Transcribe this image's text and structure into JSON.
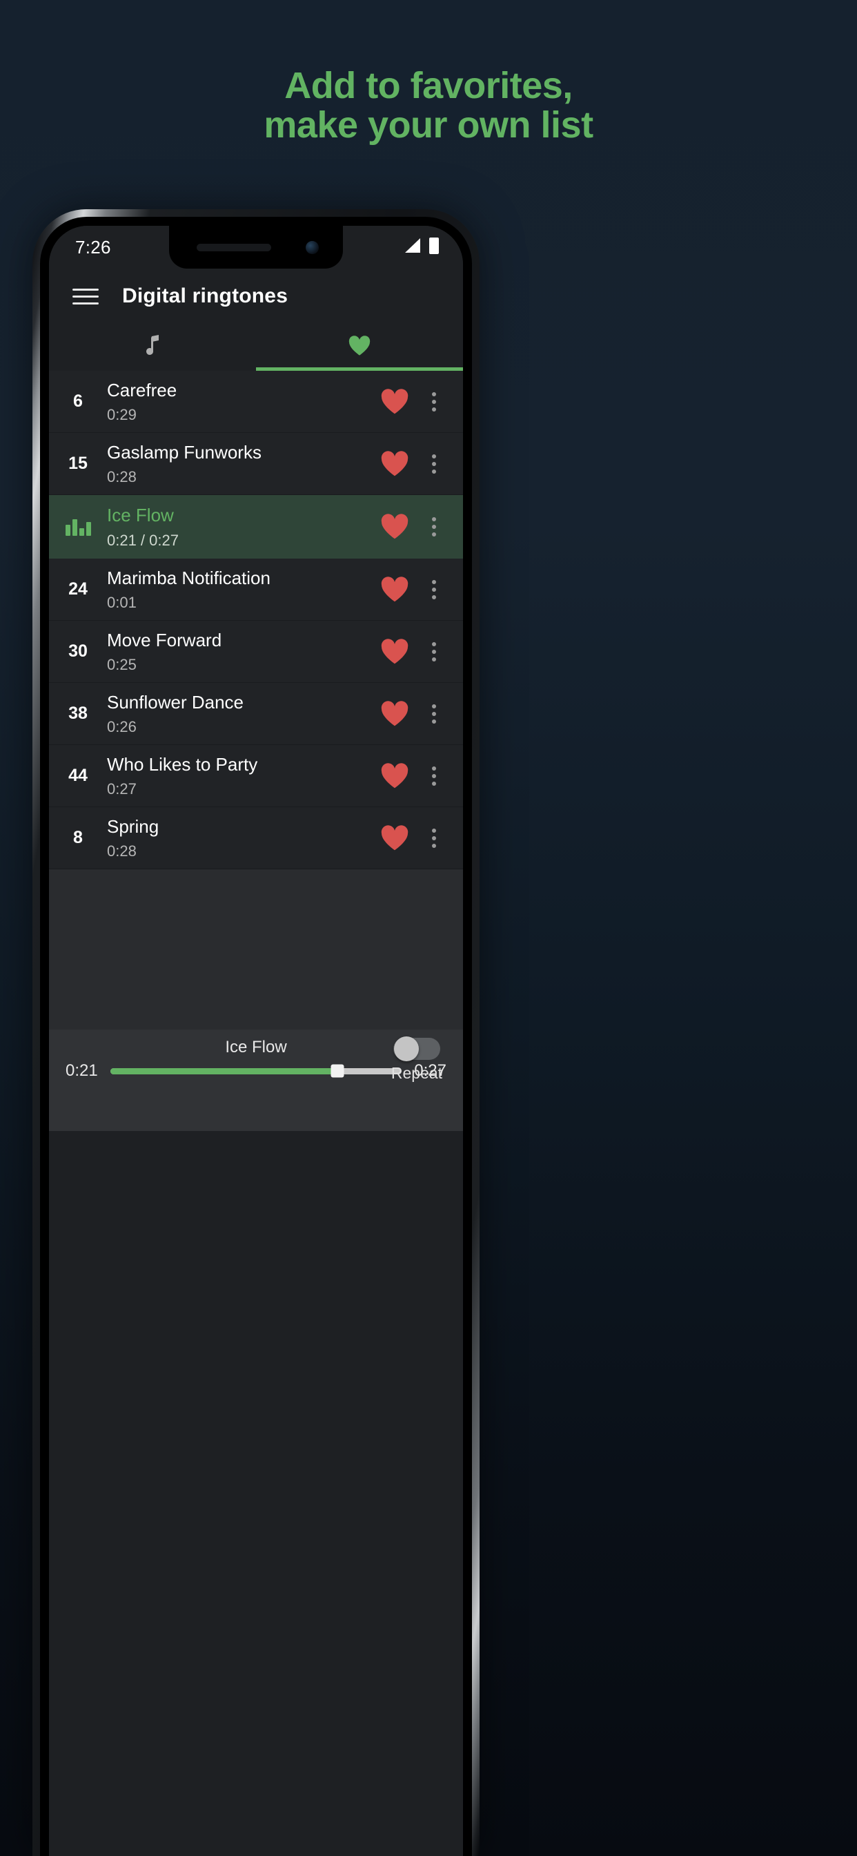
{
  "promo": {
    "headline_line1": "Add to favorites,",
    "headline_line2": "make your own list",
    "accent_color": "#62b362",
    "background_color": "#15212e"
  },
  "status_bar": {
    "time": "7:26",
    "signal_icon": "signal-bars-icon",
    "battery_icon": "battery-icon"
  },
  "app_bar": {
    "menu_icon": "hamburger-menu-icon",
    "title": "Digital ringtones"
  },
  "tabs": [
    {
      "id": "all",
      "icon": "music-note-icon",
      "label": "All ringtones",
      "selected": false
    },
    {
      "id": "favorites",
      "icon": "heart-icon",
      "label": "Favorites",
      "selected": true
    }
  ],
  "list": {
    "rows": [
      {
        "index": "6",
        "title": "Carefree",
        "duration": "0:29",
        "favorite": true,
        "playing": false
      },
      {
        "index": "15",
        "title": "Gaslamp Funworks",
        "duration": "0:28",
        "favorite": true,
        "playing": false
      },
      {
        "index": "",
        "title": "Ice Flow",
        "duration": "0:21 / 0:27",
        "favorite": true,
        "playing": true
      },
      {
        "index": "24",
        "title": "Marimba Notification",
        "duration": "0:01",
        "favorite": true,
        "playing": false
      },
      {
        "index": "30",
        "title": "Move Forward",
        "duration": "0:25",
        "favorite": true,
        "playing": false
      },
      {
        "index": "38",
        "title": "Sunflower Dance",
        "duration": "0:26",
        "favorite": true,
        "playing": false
      },
      {
        "index": "44",
        "title": "Who Likes to Party",
        "duration": "0:27",
        "favorite": true,
        "playing": false
      },
      {
        "index": "8",
        "title": "Spring",
        "duration": "0:28",
        "favorite": true,
        "playing": false
      }
    ],
    "favorite_icon": "heart-icon",
    "overflow_icon": "more-vertical-icon",
    "equalizer_icon": "equalizer-bars-icon",
    "heart_color": "#d9534f",
    "active_row_color": "#2f4538"
  },
  "player": {
    "now_playing": "Ice Flow",
    "current_time": "0:21",
    "total_time": "0:27",
    "progress_percent": 78,
    "repeat_label": "Repeat",
    "repeat_on": false,
    "progress_color": "#63b363"
  }
}
